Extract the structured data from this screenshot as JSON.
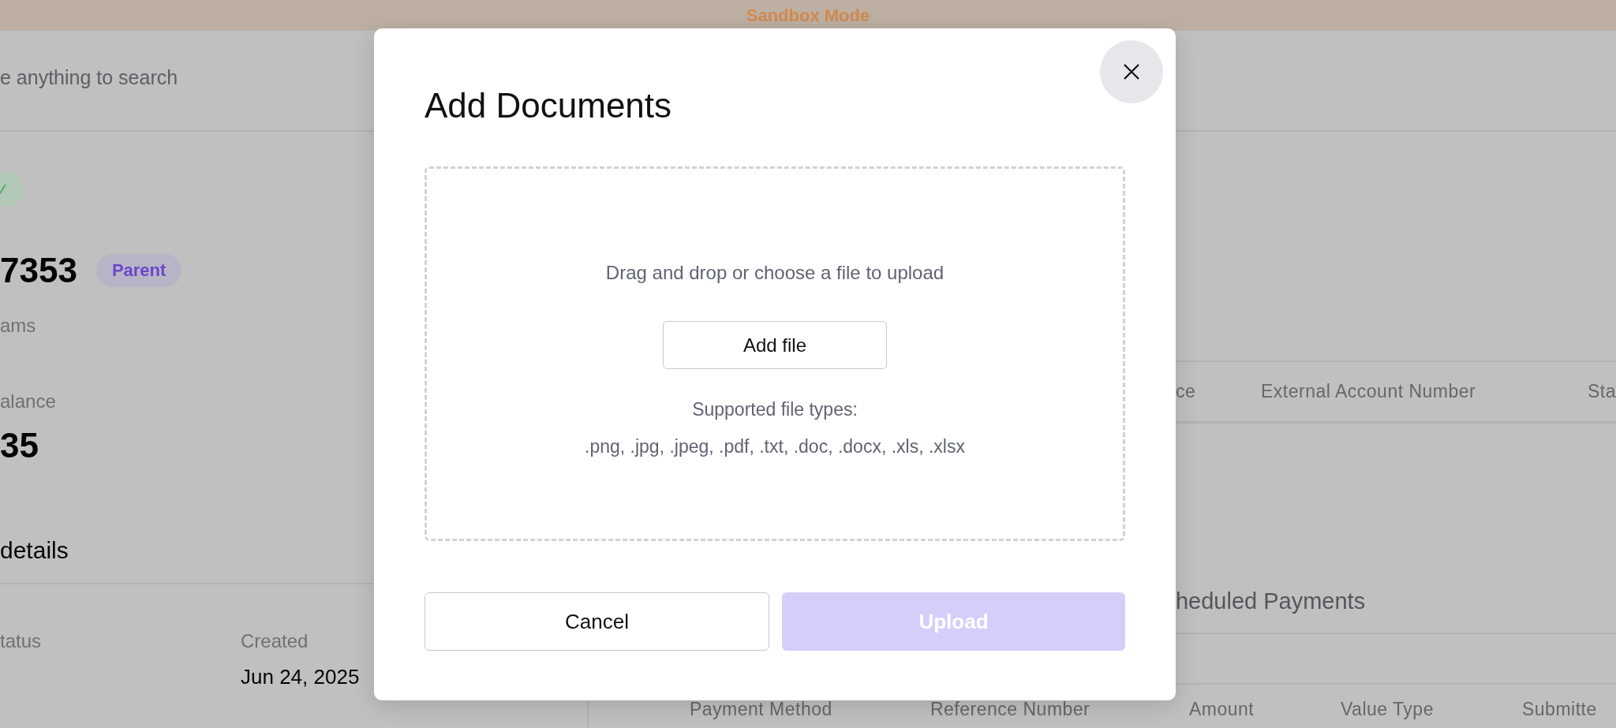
{
  "banner": {
    "text": "Sandbox Mode"
  },
  "search": {
    "placeholder": "e anything to search"
  },
  "account": {
    "number": "7353",
    "tag": "Parent",
    "subtitle": "ams",
    "balance_label": "alance",
    "balance": "35"
  },
  "details": {
    "title": "details",
    "fields": [
      {
        "label": "tatus"
      },
      {
        "label": "Created",
        "value": "Jun 24, 2025"
      }
    ]
  },
  "accounts_table": {
    "columns": [
      "ce",
      "External Account Number",
      "Sta"
    ]
  },
  "scheduled_payments": {
    "title": "heduled Payments",
    "columns": [
      "Payment Method",
      "Reference Number",
      "Amount",
      "Value Type",
      "Submitte"
    ]
  },
  "modal": {
    "title": "Add Documents",
    "dropzone": {
      "prompt": "Drag and drop or choose a file to upload",
      "button": "Add file",
      "types_label": "Supported file types:",
      "types": ".png, .jpg, .jpeg, .pdf, .txt, .doc, .docx, .xls, .xlsx"
    },
    "buttons": [
      {
        "label": "Cancel",
        "kind": "secondary",
        "disabled": false
      },
      {
        "label": "Upload",
        "kind": "primary",
        "disabled": true
      }
    ]
  }
}
